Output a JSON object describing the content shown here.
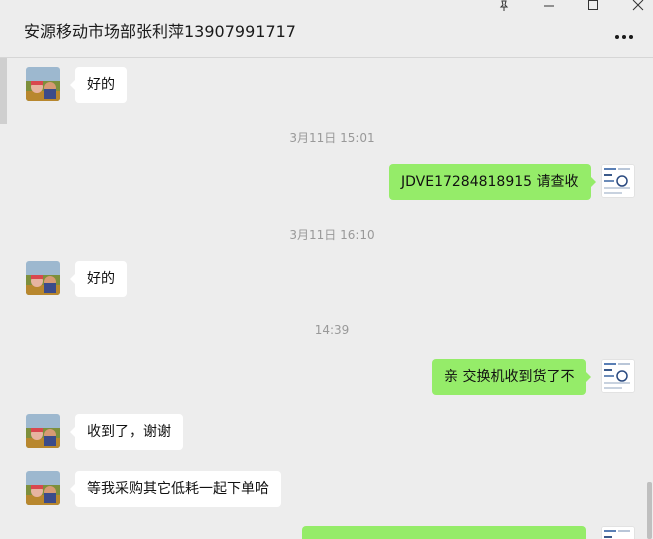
{
  "window": {
    "title": "安源移动市场部张利萍13907991717",
    "controls": [
      "pin-icon",
      "minimize-icon",
      "maximize-icon",
      "close-icon"
    ],
    "more_icon": "more-dots-icon"
  },
  "colors": {
    "sent_bubble": "#95ec69",
    "received_bubble": "#ffffff",
    "background": "#ededed"
  },
  "messages": [
    {
      "type": "received",
      "text": "好的"
    },
    {
      "type": "time",
      "text": "3月11日 15:01"
    },
    {
      "type": "sent",
      "text": "JDVE17284818915  请查收"
    },
    {
      "type": "time",
      "text": "3月11日 16:10"
    },
    {
      "type": "received",
      "text": "好的"
    },
    {
      "type": "time",
      "text": "14:39"
    },
    {
      "type": "sent",
      "text": "亲 交换机收到货了不"
    },
    {
      "type": "received",
      "text": "收到了，谢谢"
    },
    {
      "type": "received",
      "text": "等我采购其它低耗一起下单哈"
    },
    {
      "type": "sent",
      "text": ""
    }
  ]
}
